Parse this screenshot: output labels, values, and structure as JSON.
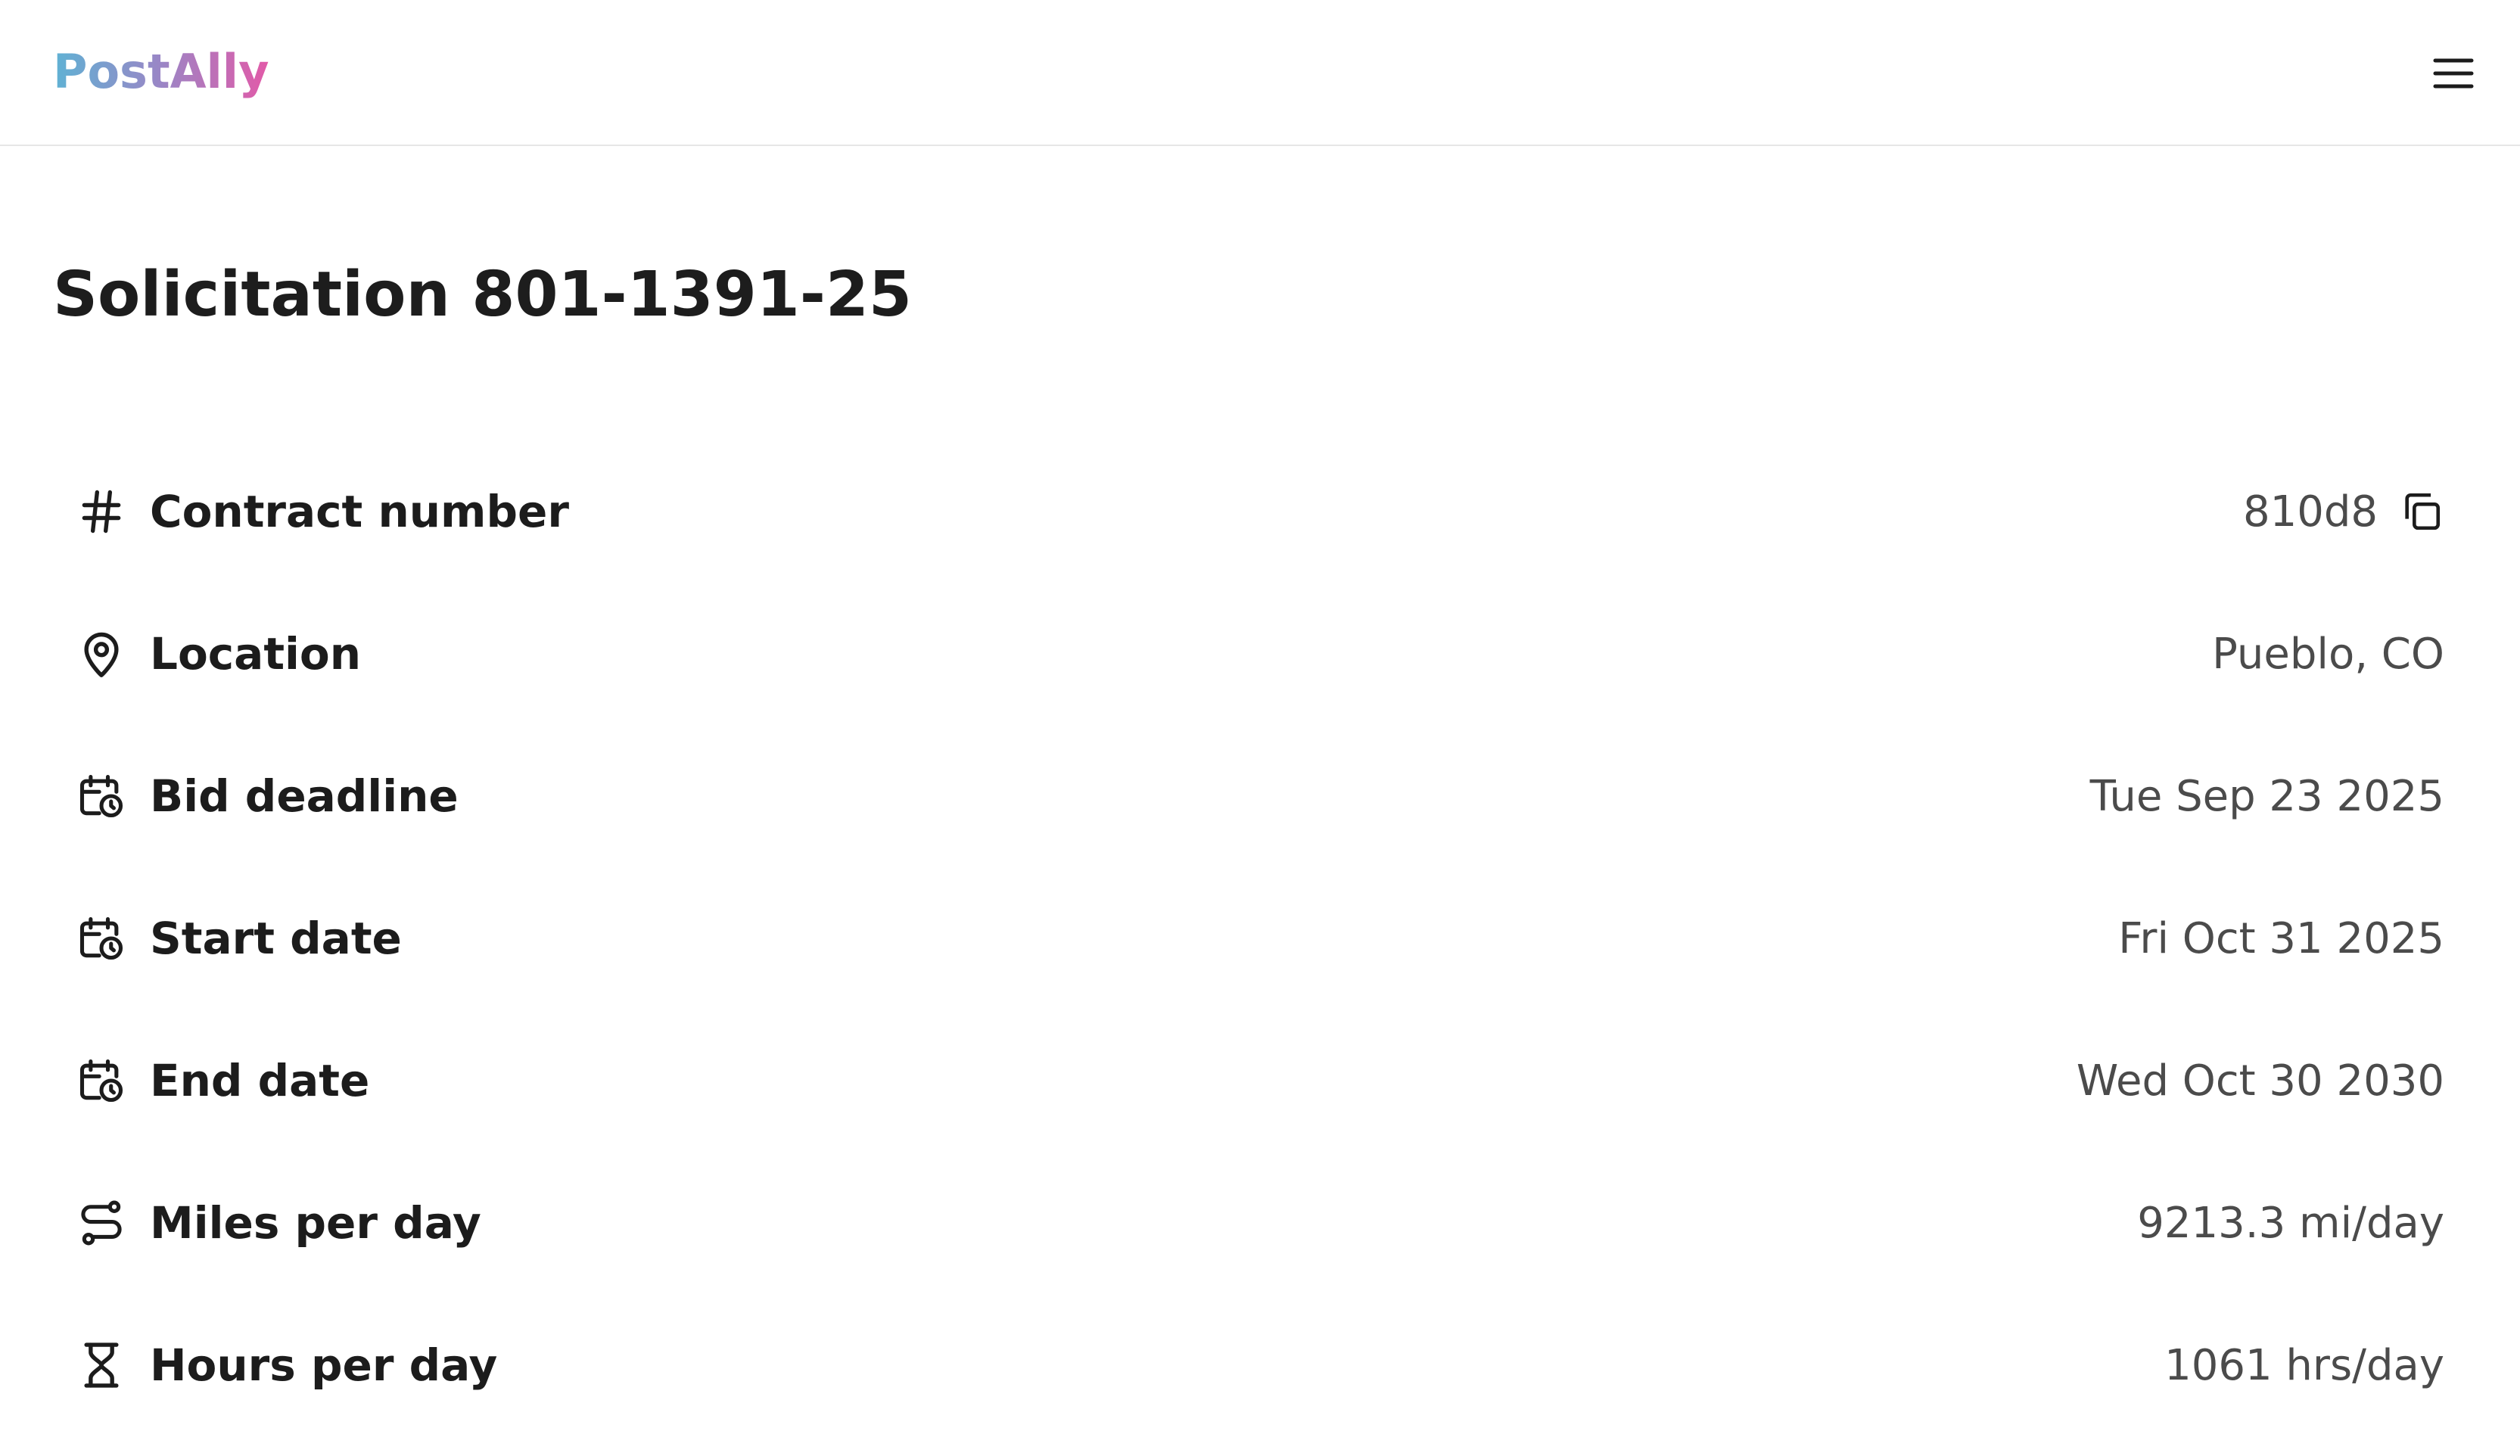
{
  "header": {
    "logo_text": "PostAlly",
    "menu_icon": "hamburger-menu-icon"
  },
  "page": {
    "title": "Solicitation 801-1391-25"
  },
  "details": [
    {
      "label": "Contract number",
      "value": "810d8",
      "icon": "hash-icon",
      "copyable": true
    },
    {
      "label": "Location",
      "value": "Pueblo, CO",
      "icon": "map-pin-icon"
    },
    {
      "label": "Bid deadline",
      "value": "Tue Sep 23 2025",
      "icon": "calendar-clock-icon"
    },
    {
      "label": "Start date",
      "value": "Fri Oct 31 2025",
      "icon": "calendar-clock-icon"
    },
    {
      "label": "End date",
      "value": "Wed Oct 30 2030",
      "icon": "calendar-clock-icon"
    },
    {
      "label": "Miles per day",
      "value": "9213.3 mi/day",
      "icon": "route-icon"
    },
    {
      "label": "Hours per day",
      "value": "1061 hrs/day",
      "icon": "hourglass-icon"
    }
  ],
  "colors": {
    "logo_gradient_start": "#5fb2d4",
    "logo_gradient_end": "#e25aa8",
    "text_primary": "#1c1c1c",
    "text_secondary": "#4b4b4b",
    "divider": "#e6e6e6"
  }
}
